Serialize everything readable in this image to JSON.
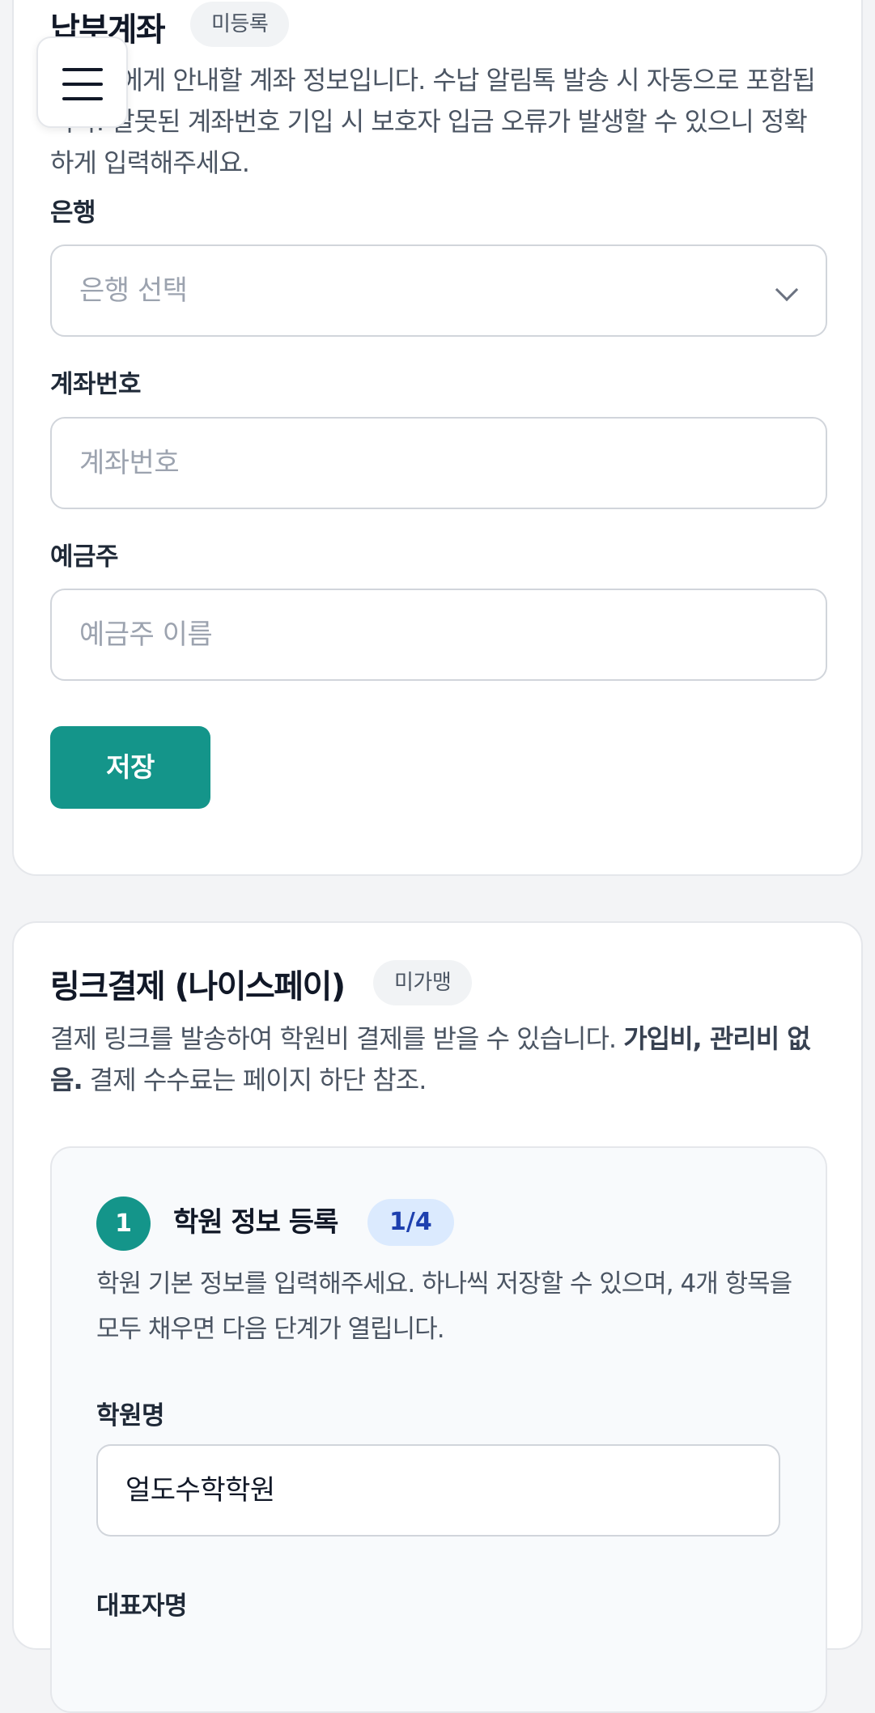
{
  "account_section": {
    "title": "납부계좌",
    "status_badge": "미등록",
    "description": "보호자에게 안내할 계좌 정보입니다. 수납 알림톡 발송 시 자동으로 포함됩니다. 잘못된 계좌번호 기입 시 보호자 입금 오류가 발생할 수 있으니 정확하게 입력해주세요.",
    "bank": {
      "label": "은행",
      "placeholder": "은행 선택"
    },
    "account_number": {
      "label": "계좌번호",
      "placeholder": "계좌번호"
    },
    "holder": {
      "label": "예금주",
      "placeholder": "예금주 이름"
    },
    "save_label": "저장"
  },
  "menu": {
    "icon": "hamburger-menu-icon"
  },
  "link_pay_section": {
    "title": "링크결제 (나이스페이)",
    "status_badge": "미가맹",
    "description_prefix": "결제 링크를 발송하여 학원비 결제를 받을 수 있습니다. ",
    "description_bold": "가입비, 관리비 없음.",
    "description_suffix": " 결제 수수료는 페이지 하단 참조.",
    "step": {
      "number": "1",
      "title": "학원 정보 등록",
      "progress": "1/4",
      "description": "학원 기본 정보를 입력해주세요. 하나씩 저장할 수 있으며, 4개 항목을 모두 채우면 다음 단계가 열립니다.",
      "academy_name": {
        "label": "학원명",
        "value": "얼도수학학원"
      },
      "representative": {
        "label": "대표자명"
      }
    }
  },
  "colors": {
    "primary": "#14958a",
    "background": "#f3f4f6",
    "badge_blue": "#dbeafe"
  }
}
